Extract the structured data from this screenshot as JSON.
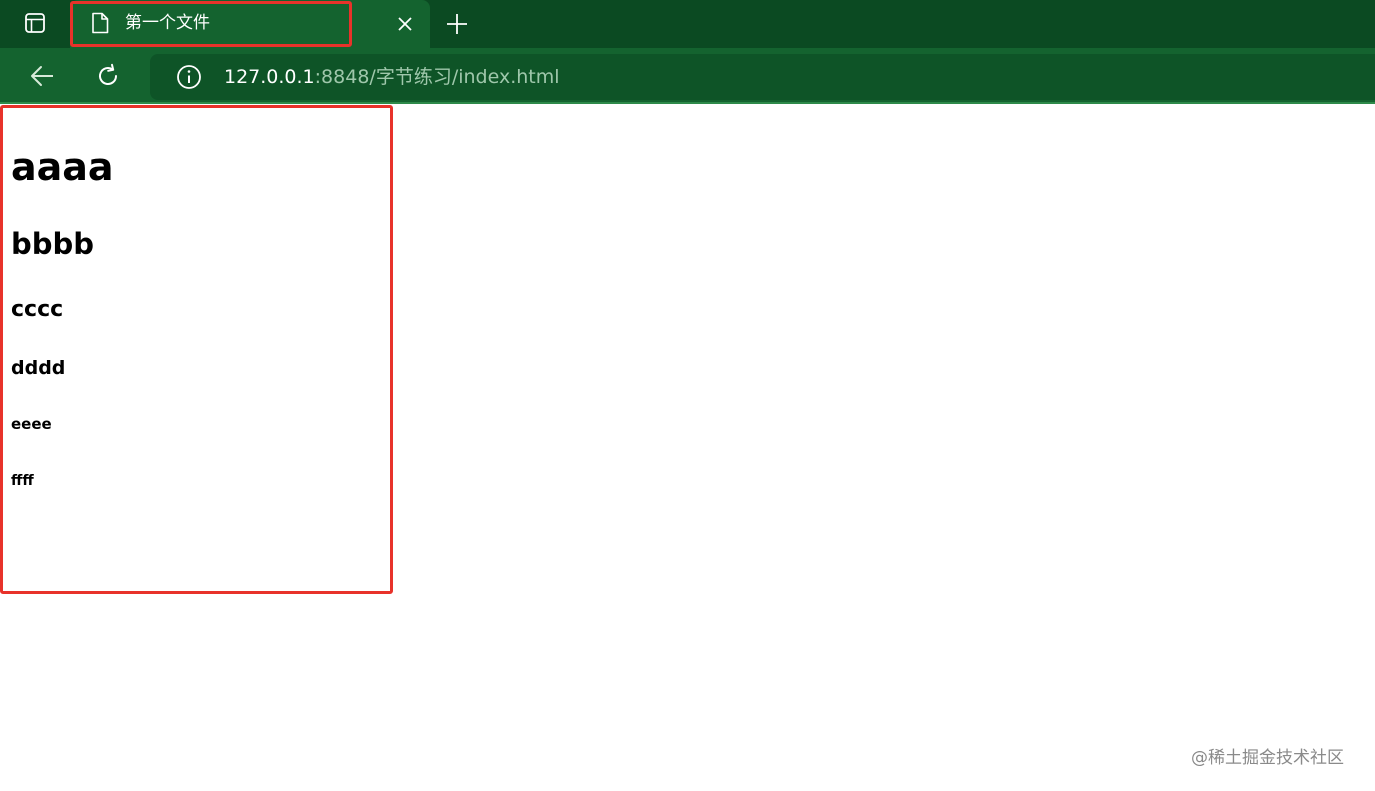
{
  "browser": {
    "tab": {
      "title": "第一个文件",
      "file_icon": "document-icon",
      "close_icon": "close-icon"
    },
    "tab_actions_icon": "tab-actions-icon",
    "new_tab_icon": "plus-icon",
    "toolbar": {
      "back_icon": "arrow-left-icon",
      "reload_icon": "reload-icon"
    },
    "address": {
      "info_icon": "info-icon",
      "host": "127.0.0.1",
      "rest": ":8848/字节练习/index.html"
    }
  },
  "page": {
    "headings": {
      "h1": "aaaa",
      "h2": "bbbb",
      "h3": "cccc",
      "h4": "dddd",
      "h5": "eeee",
      "h6": "ffff"
    }
  },
  "watermark": "@稀土掘金技术社区",
  "colors": {
    "tabbar": "#0b4a22",
    "toolbar": "#14632f",
    "highlight": "#e8322a"
  }
}
